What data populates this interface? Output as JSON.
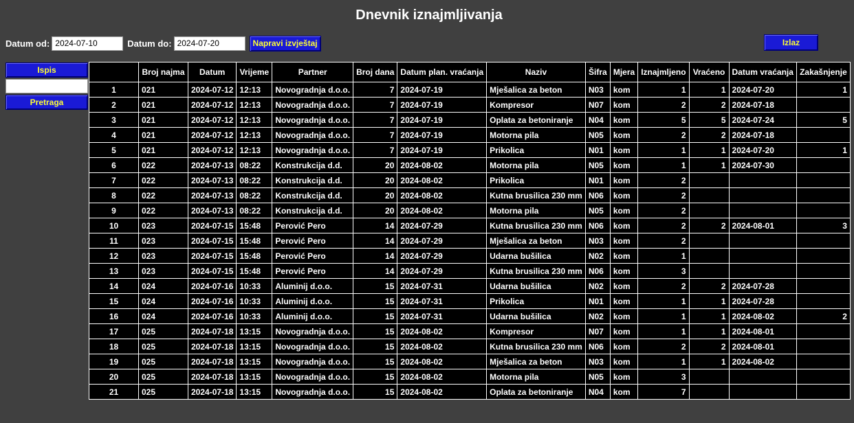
{
  "title": "Dnevnik iznajmljivanja",
  "filters": {
    "from_label": "Datum od:",
    "from_value": "2024-07-10",
    "to_label": "Datum do:",
    "to_value": "2024-07-20",
    "report_button": "Napravi izvještaj"
  },
  "exit_button": "Izlaz",
  "side": {
    "print_button": "Ispis",
    "search_value": "",
    "search_button": "Pretraga"
  },
  "colors": {
    "background": "#404040",
    "button_bg": "#1a1ad6",
    "button_text": "#ffff33",
    "table_bg": "#000000"
  },
  "table": {
    "headers": [
      "",
      "Broj najma",
      "Datum",
      "Vrijeme",
      "Partner",
      "Broj dana",
      "Datum plan. vraćanja",
      "Naziv",
      "Šifra",
      "Mjera",
      "Iznajmljeno",
      "Vraćeno",
      "Datum vraćanja",
      "Zakašnjenje"
    ],
    "rows": [
      [
        "1",
        "021",
        "2024-07-12",
        "12:13",
        "Novogradnja d.o.o.",
        "7",
        "2024-07-19",
        "Mješalica za beton",
        "N03",
        "kom",
        "1",
        "1",
        "2024-07-20",
        "1"
      ],
      [
        "2",
        "021",
        "2024-07-12",
        "12:13",
        "Novogradnja d.o.o.",
        "7",
        "2024-07-19",
        "Kompresor",
        "N07",
        "kom",
        "2",
        "2",
        "2024-07-18",
        ""
      ],
      [
        "3",
        "021",
        "2024-07-12",
        "12:13",
        "Novogradnja d.o.o.",
        "7",
        "2024-07-19",
        "Oplata za betoniranje",
        "N04",
        "kom",
        "5",
        "5",
        "2024-07-24",
        "5"
      ],
      [
        "4",
        "021",
        "2024-07-12",
        "12:13",
        "Novogradnja d.o.o.",
        "7",
        "2024-07-19",
        "Motorna pila",
        "N05",
        "kom",
        "2",
        "2",
        "2024-07-18",
        ""
      ],
      [
        "5",
        "021",
        "2024-07-12",
        "12:13",
        "Novogradnja d.o.o.",
        "7",
        "2024-07-19",
        "Prikolica",
        "N01",
        "kom",
        "1",
        "1",
        "2024-07-20",
        "1"
      ],
      [
        "6",
        "022",
        "2024-07-13",
        "08:22",
        "Konstrukcija d.d.",
        "20",
        "2024-08-02",
        "Motorna pila",
        "N05",
        "kom",
        "1",
        "1",
        "2024-07-30",
        ""
      ],
      [
        "7",
        "022",
        "2024-07-13",
        "08:22",
        "Konstrukcija d.d.",
        "20",
        "2024-08-02",
        "Prikolica",
        "N01",
        "kom",
        "2",
        "",
        "",
        ""
      ],
      [
        "8",
        "022",
        "2024-07-13",
        "08:22",
        "Konstrukcija d.d.",
        "20",
        "2024-08-02",
        "Kutna brusilica 230 mm",
        "N06",
        "kom",
        "2",
        "",
        "",
        ""
      ],
      [
        "9",
        "022",
        "2024-07-13",
        "08:22",
        "Konstrukcija d.d.",
        "20",
        "2024-08-02",
        "Motorna pila",
        "N05",
        "kom",
        "2",
        "",
        "",
        ""
      ],
      [
        "10",
        "023",
        "2024-07-15",
        "15:48",
        "Perović Pero",
        "14",
        "2024-07-29",
        "Kutna brusilica 230 mm",
        "N06",
        "kom",
        "2",
        "2",
        "2024-08-01",
        "3"
      ],
      [
        "11",
        "023",
        "2024-07-15",
        "15:48",
        "Perović Pero",
        "14",
        "2024-07-29",
        "Mješalica za beton",
        "N03",
        "kom",
        "2",
        "",
        "",
        ""
      ],
      [
        "12",
        "023",
        "2024-07-15",
        "15:48",
        "Perović Pero",
        "14",
        "2024-07-29",
        "Udarna bušilica",
        "N02",
        "kom",
        "1",
        "",
        "",
        ""
      ],
      [
        "13",
        "023",
        "2024-07-15",
        "15:48",
        "Perović Pero",
        "14",
        "2024-07-29",
        "Kutna brusilica 230 mm",
        "N06",
        "kom",
        "3",
        "",
        "",
        ""
      ],
      [
        "14",
        "024",
        "2024-07-16",
        "10:33",
        "Aluminij d.o.o.",
        "15",
        "2024-07-31",
        "Udarna bušilica",
        "N02",
        "kom",
        "2",
        "2",
        "2024-07-28",
        ""
      ],
      [
        "15",
        "024",
        "2024-07-16",
        "10:33",
        "Aluminij d.o.o.",
        "15",
        "2024-07-31",
        "Prikolica",
        "N01",
        "kom",
        "1",
        "1",
        "2024-07-28",
        ""
      ],
      [
        "16",
        "024",
        "2024-07-16",
        "10:33",
        "Aluminij d.o.o.",
        "15",
        "2024-07-31",
        "Udarna bušilica",
        "N02",
        "kom",
        "1",
        "1",
        "2024-08-02",
        "2"
      ],
      [
        "17",
        "025",
        "2024-07-18",
        "13:15",
        "Novogradnja d.o.o.",
        "15",
        "2024-08-02",
        "Kompresor",
        "N07",
        "kom",
        "1",
        "1",
        "2024-08-01",
        ""
      ],
      [
        "18",
        "025",
        "2024-07-18",
        "13:15",
        "Novogradnja d.o.o.",
        "15",
        "2024-08-02",
        "Kutna brusilica 230 mm",
        "N06",
        "kom",
        "2",
        "2",
        "2024-08-01",
        ""
      ],
      [
        "19",
        "025",
        "2024-07-18",
        "13:15",
        "Novogradnja d.o.o.",
        "15",
        "2024-08-02",
        "Mješalica za beton",
        "N03",
        "kom",
        "1",
        "1",
        "2024-08-02",
        ""
      ],
      [
        "20",
        "025",
        "2024-07-18",
        "13:15",
        "Novogradnja d.o.o.",
        "15",
        "2024-08-02",
        "Motorna pila",
        "N05",
        "kom",
        "3",
        "",
        "",
        ""
      ],
      [
        "21",
        "025",
        "2024-07-18",
        "13:15",
        "Novogradnja d.o.o.",
        "15",
        "2024-08-02",
        "Oplata za betoniranje",
        "N04",
        "kom",
        "7",
        "",
        "",
        ""
      ]
    ]
  }
}
